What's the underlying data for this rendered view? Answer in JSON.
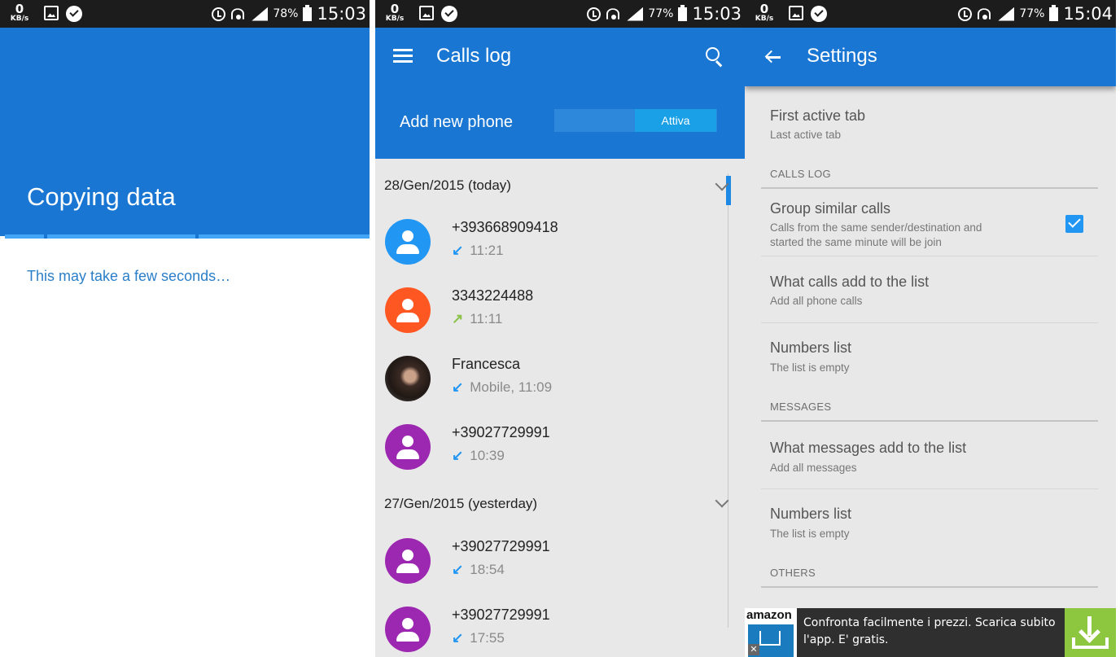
{
  "panel1": {
    "status": {
      "kbs_value": "0",
      "kbs_unit": "KB/s",
      "battery": "78%",
      "time": "15:03"
    },
    "title": "Copying data",
    "subtitle": "This may take a few seconds…"
  },
  "panel2": {
    "status": {
      "kbs_value": "0",
      "kbs_unit": "KB/s",
      "battery": "77%",
      "time": "15:03"
    },
    "appbar_title": "Calls log",
    "add_new_phone": "Add new phone",
    "toggle_label": "Attiva",
    "groups": [
      {
        "date": "28/Gen/2015 (today)",
        "calls": [
          {
            "name": "+393668909418",
            "meta": "11:21",
            "direction": "incoming",
            "avatar_color": "#2196f3"
          },
          {
            "name": "3343224488",
            "meta": "11:11",
            "direction": "outgoing",
            "avatar_color": "#ff5722"
          },
          {
            "name": "Francesca",
            "meta": "Mobile, 11:09",
            "direction": "incoming",
            "avatar_color": "photo"
          },
          {
            "name": "+39027729991",
            "meta": "10:39",
            "direction": "incoming",
            "avatar_color": "#9c27b0"
          }
        ]
      },
      {
        "date": "27/Gen/2015 (yesterday)",
        "calls": [
          {
            "name": "+39027729991",
            "meta": "18:54",
            "direction": "incoming",
            "avatar_color": "#9c27b0"
          },
          {
            "name": "+39027729991",
            "meta": "17:55",
            "direction": "incoming",
            "avatar_color": "#9c27b0"
          }
        ]
      }
    ]
  },
  "panel3": {
    "status": {
      "kbs_value": "0",
      "kbs_unit": "KB/s",
      "battery": "77%",
      "time": "15:04"
    },
    "appbar_title": "Settings",
    "first_tab": {
      "title": "First active tab",
      "sub": "Last active tab"
    },
    "cat_calls": "CALLS LOG",
    "group_similar": {
      "title": "Group similar calls",
      "sub1": "Calls from the same sender/destination and",
      "sub2": "started the same minute will be join",
      "checked": true
    },
    "what_calls": {
      "title": "What calls add to the list",
      "sub": "Add all phone calls"
    },
    "numbers1": {
      "title": "Numbers list",
      "sub": "The list is empty"
    },
    "cat_messages": "MESSAGES",
    "what_messages": {
      "title": "What messages add to the list",
      "sub": "Add all messages"
    },
    "numbers2": {
      "title": "Numbers list",
      "sub": "The list is empty"
    },
    "cat_others": "OTHERS",
    "ad": {
      "brand": "amazon",
      "text": "Confronta facilmente i prezzi. Scarica subito l'app. E' gratis.",
      "close": "✕"
    }
  },
  "colors": {
    "primary": "#1976d2",
    "accent": "#2196f3",
    "incoming": "#2196f3",
    "outgoing": "#8bc34a"
  }
}
